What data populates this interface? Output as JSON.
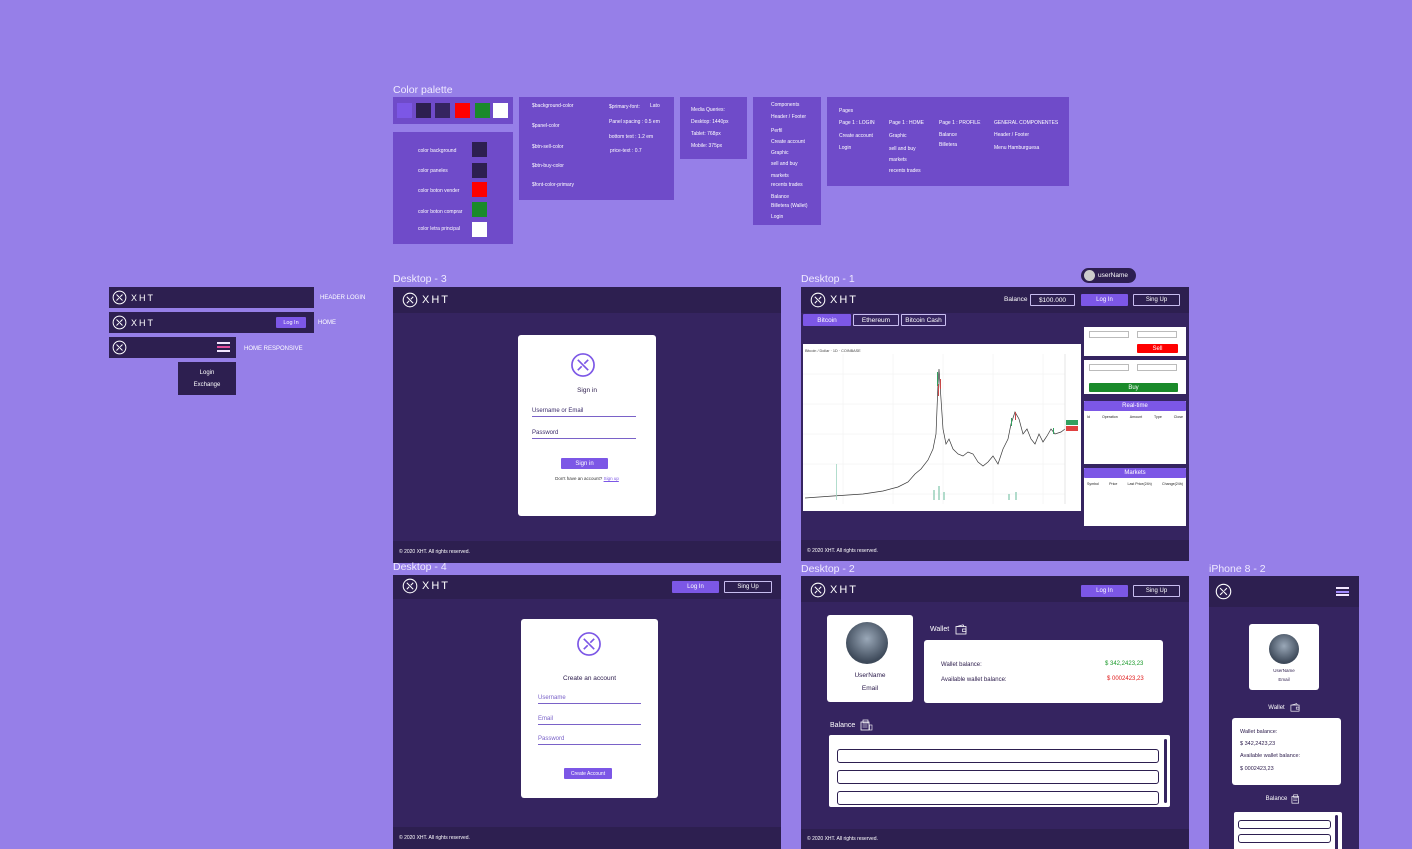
{
  "colors": {
    "background": "#967fe8",
    "panel": "#6f4bc9",
    "dark": "#2d1f50",
    "frame": "#352460",
    "primary": "#7c57e6",
    "sell": "#ff0000",
    "buy": "#1a8a2a",
    "white": "#ffffff"
  },
  "palette": {
    "title": "Color palette",
    "swatches": [
      "#7c57e6",
      "#2d1f50",
      "#352460",
      "#ff0000",
      "#1a8a2a",
      "#ffffff"
    ],
    "color_labels": [
      {
        "label": "color background",
        "color": "#2d1f50"
      },
      {
        "label": "color paneles",
        "color": "#2d1f50"
      },
      {
        "label": "color boton vender",
        "color": "#ff0000"
      },
      {
        "label": "color boton comprar",
        "color": "#1a8a2a"
      },
      {
        "label": "color letra principal",
        "color": "#ffffff"
      }
    ]
  },
  "variables": {
    "left": [
      "$background-color",
      "$panel-color",
      "$btn-sell-color",
      "$btn-buy-color",
      "$font-color-primary"
    ],
    "right": [
      "$primary-font:",
      "Panel spacing : 0.5 em",
      "bottom text : 1.2 em",
      "price-text : 0.7"
    ],
    "font_value": "Lato"
  },
  "media": {
    "title": "Media Queries:",
    "items": [
      "Desktop:   1440px",
      "Tablet:  768px",
      "Mobile:   375px"
    ]
  },
  "components": {
    "items": [
      "Components",
      "Header / Footer",
      "Perfil",
      "Create account",
      "Graphic",
      "sell and buy",
      "markets",
      "recents trades",
      "Balance",
      "Billetera (Wallet)",
      "Login"
    ]
  },
  "pages": {
    "title": "Pages",
    "col1": [
      "Page 1 : LOGIN",
      "Create account",
      "Login"
    ],
    "col2": [
      "Page 1 : HOME",
      "Graphic",
      "sell and buy",
      "markets",
      "recents trades"
    ],
    "col3": [
      "Page 1 : PROFILE",
      "Balance",
      "Billetera"
    ],
    "col4": [
      "GENERAL COMPONENTES",
      "Header / Footer",
      "Menu Hamburguesa"
    ]
  },
  "headers": {
    "logo_text": "XHT",
    "login_label": "HEADER LOGIN",
    "home_label": "HOME",
    "responsive_label": "HOME RESPONSIVE",
    "login_btn": "Log In",
    "menu_items": [
      "Login",
      "Exchange"
    ]
  },
  "desktop3": {
    "title": "Desktop - 3",
    "sign_in": "Sign in",
    "user_field": "Username or Email",
    "pass_field": "Password",
    "submit": "Sign in",
    "no_account": "Don't have an account?",
    "signup_link": "Sign up",
    "footer": "© 2020 XHT. All rights reserved."
  },
  "desktop1": {
    "title": "Desktop - 1",
    "user_chip": "userName",
    "balance_label": "Balance",
    "balance_value": "$100.000",
    "login": "Log In",
    "signup": "Sing Up",
    "tabs": [
      "Bitcoin",
      "Ethereum",
      "Bitcoin Cash"
    ],
    "sell": "Sell",
    "buy": "Buy",
    "realtime": "Real-time",
    "realtime_cols": [
      "Id",
      "Operation",
      "Amount",
      "Type",
      "Close"
    ],
    "markets": "Markets",
    "markets_cols": [
      "Symbol",
      "Price",
      "Last Price(24h)",
      "Change(24h)"
    ],
    "chart_title": "Bitcoin / Dollar · 1D · COINBASE",
    "footer": "© 2020 XHT. All rights reserved."
  },
  "desktop4": {
    "title": "Desktop - 4",
    "login": "Log In",
    "signup": "Sing Up",
    "heading": "Create an account",
    "user": "Username",
    "email": "Email",
    "pass": "Password",
    "submit": "Create Account",
    "footer": "© 2020 XHT. All rights reserved."
  },
  "desktop2": {
    "title": "Desktop - 2",
    "login": "Log In",
    "signup": "Sing Up",
    "user_name": "UserName",
    "email": "Email",
    "wallet": "Wallet",
    "wallet_balance_label": "Wallet balance:",
    "wallet_balance": "$ 342,2423,23",
    "available_label": "Available  wallet balance:",
    "available": "$ 0002423,23",
    "balance": "Balance",
    "footer": "© 2020 XHT. All rights reserved."
  },
  "iphone": {
    "title": "iPhone 8 - 2",
    "user_name": "UserName",
    "email": "Email",
    "wallet": "Wallet",
    "wallet_balance_label": "Wallet balance:",
    "wallet_balance": "$ 342,2423,23",
    "available_label": "Available  wallet balance:",
    "available": "$ 0002423,23",
    "balance": "Balance"
  }
}
